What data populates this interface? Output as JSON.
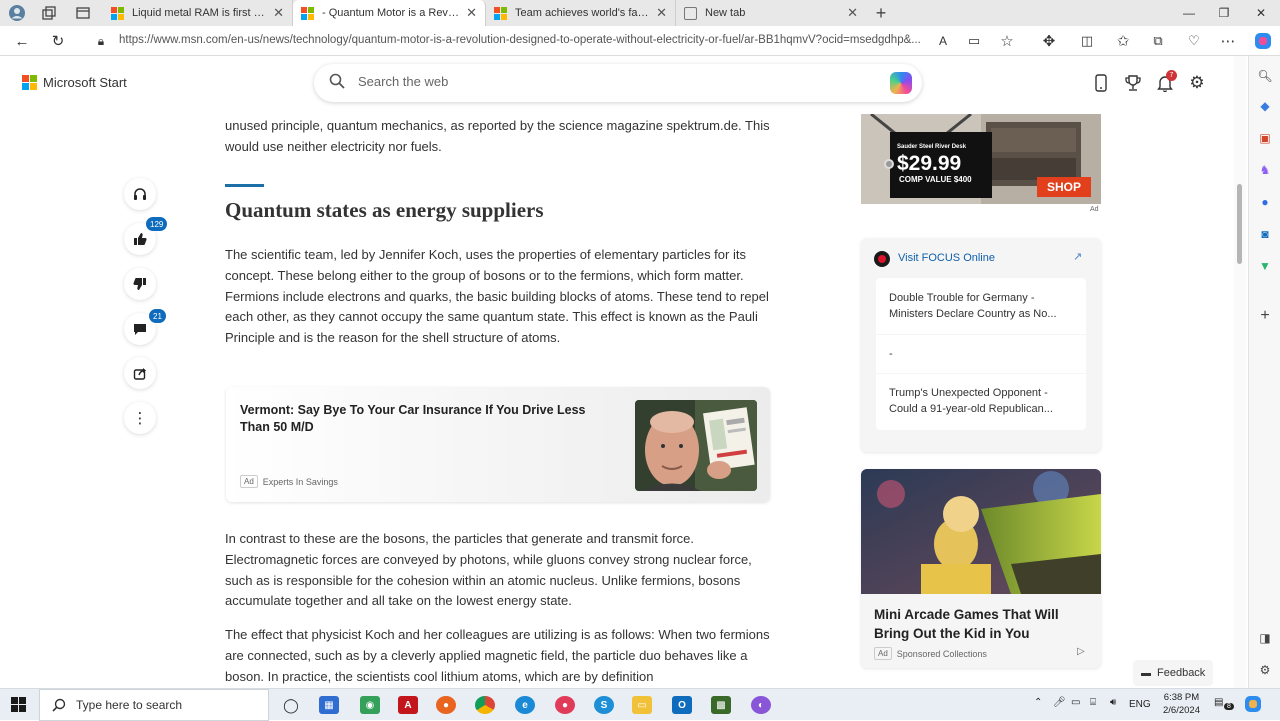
{
  "tabs": [
    {
      "title": "Liquid metal RAM is first step tow",
      "favicon": "msn"
    },
    {
      "title": "- Quantum Motor is a Revolution",
      "favicon": "msn",
      "active": true
    },
    {
      "title": "Team achieves world's fastest da",
      "favicon": "msn"
    },
    {
      "title": "New tab",
      "favicon": "newtab"
    }
  ],
  "url": "https://www.msn.com/en-us/news/technology/quantum-motor-is-a-revolution-designed-to-operate-without-electricity-or-fuel/ar-BB1hqmvV?ocid=msedgdhp&...",
  "msn": {
    "brand": "Microsoft Start",
    "search_placeholder": "Search the web",
    "notification_count": "7"
  },
  "reactions": {
    "likes": "129",
    "comments": "21"
  },
  "article": {
    "intro": "unused principle, quantum mechanics, as reported by the science magazine spektrum.de. This would use neither electricity nor fuels.",
    "heading": "Quantum states as energy suppliers",
    "p1": "The scientific team, led by Jennifer Koch, uses the properties of elementary particles for its concept. These belong either to the group of bosons or to the fermions, which form matter. Fermions include electrons and quarks, the basic building blocks of atoms. These tend to repel each other, as they cannot occupy the same quantum state. This effect is known as the Pauli Principle and is the reason for the shell structure of atoms.",
    "p2": "In contrast to these are the bosons, the particles that generate and transmit force. Electromagnetic forces are conveyed by photons, while gluons convey strong nuclear force, such as is responsible for the cohesion within an atomic nucleus. Unlike fermions, bosons accumulate together and all take on the lowest energy state.",
    "p3": "The effect that physicist Koch and her colleagues are utilizing is as follows: When two fermions are connected, such as by a cleverly applied magnetic field, the particle duo behaves like a boson. In practice, the scientists cool lithium atoms, which are by definition"
  },
  "inline_ad": {
    "title": "Vermont: Say Bye To Your Car Insurance If You Drive Less Than 50 M/D",
    "ad_label": "Ad",
    "source": "Experts In Savings"
  },
  "top_ad": {
    "product": "Sauder Steel River Desk",
    "price": "$29.99",
    "comp": "COMP VALUE $400",
    "cta": "SHOP",
    "ad_label": "Ad"
  },
  "focus_card": {
    "link": "Visit FOCUS Online",
    "items": [
      "Double Trouble for Germany - Ministers Declare Country as No...",
      "-",
      "Trump's Unexpected Opponent - Could a 91-year-old Republican..."
    ]
  },
  "arcade_card": {
    "title": "Mini Arcade Games That Will Bring Out the Kid in You",
    "ad_label": "Ad",
    "source": "Sponsored Collections"
  },
  "feedback_label": "Feedback",
  "taskbar": {
    "search_placeholder": "Type here to search",
    "language": "ENG",
    "time": "6:38 PM",
    "date": "2/6/2024",
    "notification_count": "8"
  },
  "colors": {
    "accent": "#0f6cbd",
    "section_rule": "#1d6fa8",
    "taskbar": "#e9eef5"
  }
}
